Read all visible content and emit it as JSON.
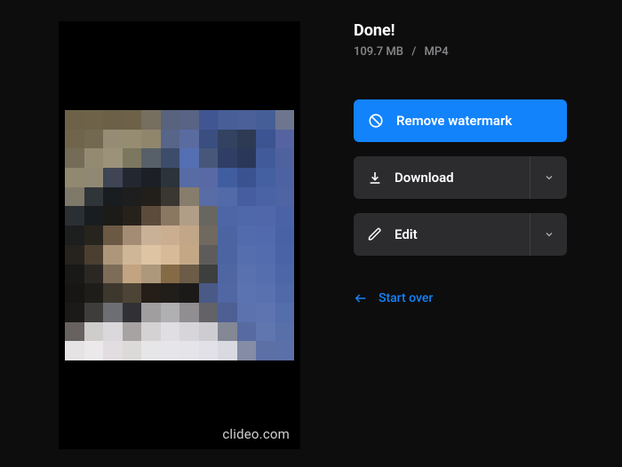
{
  "title": "Done!",
  "meta": {
    "size": "109.7 MB",
    "separator": "/",
    "format": "MP4"
  },
  "actions": {
    "remove_watermark": "Remove watermark",
    "download": "Download",
    "edit": "Edit",
    "start_over": "Start over"
  },
  "watermark": "clideo.com",
  "mosaic_colors": [
    [
      "#6d6147",
      "#6e6249",
      "#6c6048",
      "#6d6148",
      "#766e5f",
      "#58637d",
      "#586385",
      "#415592",
      "#475e97",
      "#4b6099",
      "#465e98",
      "#6d768e"
    ],
    [
      "#70654b",
      "#726950",
      "#968c75",
      "#958c72",
      "#90866c",
      "#576589",
      "#5a6ba0",
      "#3b4e80",
      "#324260",
      "#2e3a54",
      "#3c5491",
      "#5563a2"
    ],
    [
      "#746c56",
      "#948a72",
      "#9c927a",
      "#7c775f",
      "#575f68",
      "#3d4c6a",
      "#546fb2",
      "#47577a",
      "#2f3e65",
      "#2b3759",
      "#415b9a",
      "#4f62a0"
    ],
    [
      "#918870",
      "#908872",
      "#3f4555",
      "#232830",
      "#1c1f26",
      "#2b333b",
      "#576ba4",
      "#5869a5",
      "#405e9f",
      "#3b5291",
      "#4560a0",
      "#4c62a2"
    ],
    [
      "#7e7969",
      "#303539",
      "#191d20",
      "#1d1e1d",
      "#221f1b",
      "#3a3630",
      "#877d6d",
      "#586ca6",
      "#536aa9",
      "#465ea0",
      "#4963a5",
      "#4e64a3"
    ],
    [
      "#2a2f34",
      "#191d1f",
      "#1d1b17",
      "#27211c",
      "#5c4b3b",
      "#8b7862",
      "#b29e86",
      "#676660",
      "#4e66a5",
      "#4f68aa",
      "#5068a9",
      "#4a63a6"
    ],
    [
      "#1d1e1e",
      "#27231d",
      "#6b5944",
      "#a38c73",
      "#c9b197",
      "#caae8f",
      "#c1a787",
      "#706960",
      "#4c64a2",
      "#526bad",
      "#506aad",
      "#4762a5"
    ],
    [
      "#26231e",
      "#4c3f30",
      "#ae967b",
      "#cfb696",
      "#dfc4a4",
      "#d7bb99",
      "#c4a886",
      "#5e5c5b",
      "#4c64a2",
      "#556eae",
      "#526cae",
      "#4864a6"
    ],
    [
      "#191918",
      "#2b2824",
      "#7d6c58",
      "#c2a481",
      "#ad987c",
      "#856a46",
      "#6b5b47",
      "#3d3e3e",
      "#4f66a3",
      "#5971af",
      "#556eae",
      "#4c67a7"
    ],
    [
      "#181614",
      "#1f1d19",
      "#3d372e",
      "#4d4436",
      "#241d18",
      "#201d1a",
      "#1b1a19",
      "#4a5a87",
      "#5067a3",
      "#5b73b0",
      "#5971af",
      "#5069a8"
    ],
    [
      "#1c1a18",
      "#3e3d3c",
      "#6c6e73",
      "#313034",
      "#a19ea0",
      "#b0afb2",
      "#908e91",
      "#626267",
      "#4d5f93",
      "#5b72ae",
      "#5d74b0",
      "#546dab"
    ],
    [
      "#676260",
      "#cfcccc",
      "#dad8db",
      "#a7a3a3",
      "#d5d2d3",
      "#e0dee3",
      "#d7d5da",
      "#cdccd1",
      "#848895",
      "#576ba2",
      "#6076af",
      "#596fa9"
    ],
    [
      "#e5e3e3",
      "#ebe9ea",
      "#e1dde0",
      "#dcd9d9",
      "#e6e5e8",
      "#e6e5e9",
      "#e5e4e9",
      "#e2e1e7",
      "#d9dae1",
      "#848ca6",
      "#5c70a5",
      "#5b70a8"
    ]
  ]
}
